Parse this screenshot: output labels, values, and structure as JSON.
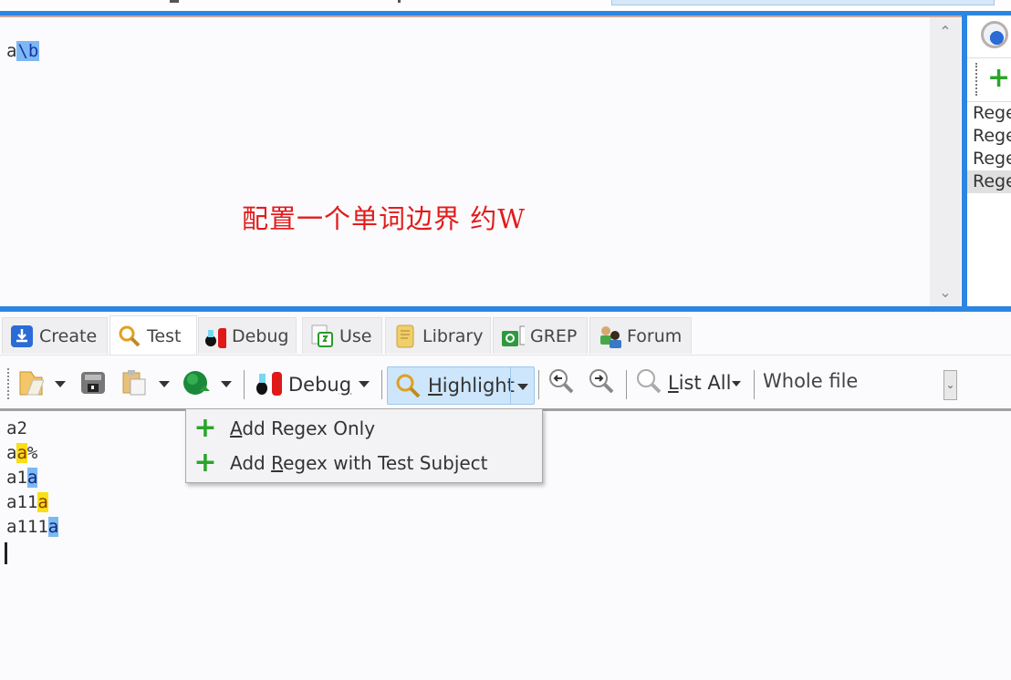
{
  "regex_editor": {
    "regex_plain": "a",
    "regex_highlighted": "\\b",
    "annotation": "配置一个单词边界  约W",
    "scroll_up": "^",
    "scroll_down": "v"
  },
  "side_panel": {
    "history_icon": "clock-icon",
    "add_icon": "plus-icon",
    "items": [
      "Regex",
      "Regex",
      "Regex",
      "Regex"
    ],
    "selected_index": 3
  },
  "tabs": [
    {
      "label": "Create",
      "icon": "create-icon"
    },
    {
      "label": "Test",
      "icon": "magnifier-icon",
      "active": true
    },
    {
      "label": "Debug",
      "icon": "bug-icon"
    },
    {
      "label": "Use",
      "icon": "use-icon"
    },
    {
      "label": "Library",
      "icon": "library-icon"
    },
    {
      "label": "GREP",
      "icon": "grep-icon"
    },
    {
      "label": "Forum",
      "icon": "forum-icon"
    }
  ],
  "toolbar": {
    "debug_label_pre": "Debu",
    "debug_label_u": "g",
    "highlight_label_u": "H",
    "highlight_label_rest": "ighlight",
    "list_all_u": "L",
    "list_all_rest": "ist All",
    "scope_value": "Whole file"
  },
  "subject_lines": [
    {
      "segments": [
        {
          "t": "a2",
          "h": ""
        }
      ]
    },
    {
      "segments": [
        {
          "t": "a",
          "h": ""
        },
        {
          "t": "a",
          "h": "y"
        },
        {
          "t": "%",
          "h": ""
        }
      ]
    },
    {
      "segments": [
        {
          "t": "a1",
          "h": ""
        },
        {
          "t": "a",
          "h": "b"
        }
      ]
    },
    {
      "segments": [
        {
          "t": "a11",
          "h": ""
        },
        {
          "t": "a",
          "h": "y"
        }
      ]
    },
    {
      "segments": [
        {
          "t": "a111",
          "h": ""
        },
        {
          "t": "a",
          "h": "b"
        }
      ]
    }
  ],
  "menu": {
    "items": [
      {
        "u": "A",
        "rest": "dd Regex Only",
        "pre": ""
      },
      {
        "pre": "Add ",
        "u": "R",
        "rest": "egex with Test Subject"
      }
    ]
  },
  "colors": {
    "accent_blue": "#2b86e2",
    "annotation_red": "#e21c1c",
    "match_yellow": "#f8e012",
    "match_blue": "#7cb8f2",
    "plus_green": "#2aa52a"
  }
}
